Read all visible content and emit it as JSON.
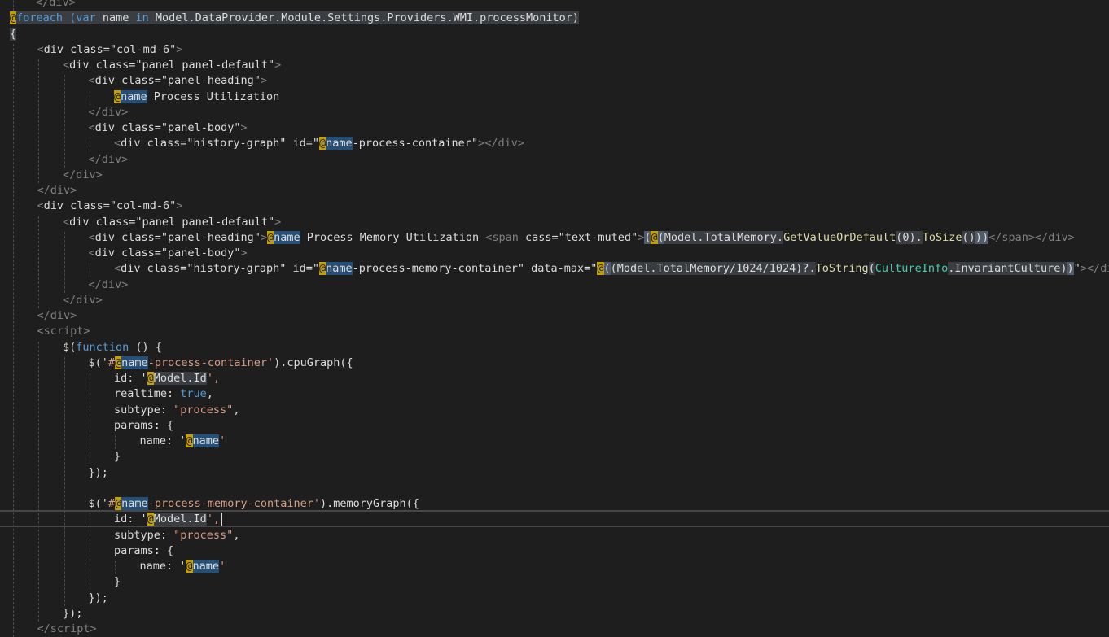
{
  "editor": {
    "theme_colors": {
      "background": "#1e1e1e",
      "razor_marker": "#c4a000",
      "keyword": "#569cd6",
      "tag_bracket": "#808080",
      "js_string": "#d69d85",
      "type": "#4ec9b0",
      "method": "#dcdcaa"
    },
    "current_line_index": 33,
    "lines": [
      {
        "indent": 1,
        "tokens": [
          {
            "t": "</div>",
            "k": "tag"
          }
        ]
      },
      {
        "indent": 0,
        "tokens": [
          {
            "t": "@",
            "k": "razor"
          },
          {
            "t": "foreach (",
            "k": "keyword"
          },
          {
            "t": "var",
            "k": "keyword"
          },
          {
            "t": " name ",
            "k": "plain"
          },
          {
            "t": "in",
            "k": "keyword"
          },
          {
            "t": " Model.DataProvider.Module.Settings.Providers.WMI.processMonitor)",
            "k": "plain"
          }
        ],
        "block_bg": true
      },
      {
        "indent": 0,
        "tokens": [
          {
            "t": "{",
            "k": "plain"
          }
        ],
        "block_bg": true
      },
      {
        "indent": 1,
        "tokens": [
          {
            "t": "<",
            "k": "tag"
          },
          {
            "t": "div",
            "k": "tagname"
          },
          {
            "t": " class=\"col-md-6\"",
            "k": "attr"
          },
          {
            "t": ">",
            "k": "tag"
          }
        ]
      },
      {
        "indent": 2,
        "tokens": [
          {
            "t": "<",
            "k": "tag"
          },
          {
            "t": "div",
            "k": "tagname"
          },
          {
            "t": " class=\"panel panel-default\"",
            "k": "attr"
          },
          {
            "t": ">",
            "k": "tag"
          }
        ]
      },
      {
        "indent": 3,
        "tokens": [
          {
            "t": "<",
            "k": "tag"
          },
          {
            "t": "div",
            "k": "tagname"
          },
          {
            "t": " class=\"panel-heading\"",
            "k": "attr"
          },
          {
            "t": ">",
            "k": "tag"
          }
        ]
      },
      {
        "indent": 4,
        "tokens": [
          {
            "t": "@",
            "k": "razor"
          },
          {
            "t": "name",
            "k": "varbox"
          },
          {
            "t": " Process Utilization",
            "k": "text"
          }
        ]
      },
      {
        "indent": 3,
        "tokens": [
          {
            "t": "</",
            "k": "tag"
          },
          {
            "t": "div",
            "k": "tag"
          },
          {
            "t": ">",
            "k": "tag"
          }
        ]
      },
      {
        "indent": 3,
        "tokens": [
          {
            "t": "<",
            "k": "tag"
          },
          {
            "t": "div",
            "k": "tagname"
          },
          {
            "t": " class=\"panel-body\"",
            "k": "attr"
          },
          {
            "t": ">",
            "k": "tag"
          }
        ]
      },
      {
        "indent": 4,
        "tokens": [
          {
            "t": "<",
            "k": "tag"
          },
          {
            "t": "div",
            "k": "tagname"
          },
          {
            "t": " class=\"history-graph\" id=\"",
            "k": "attr"
          },
          {
            "t": "@",
            "k": "razor"
          },
          {
            "t": "name",
            "k": "varbox"
          },
          {
            "t": "-process-container\"",
            "k": "attr"
          },
          {
            "t": "></",
            "k": "tag"
          },
          {
            "t": "div",
            "k": "tag"
          },
          {
            "t": ">",
            "k": "tag"
          }
        ]
      },
      {
        "indent": 3,
        "tokens": [
          {
            "t": "</",
            "k": "tag"
          },
          {
            "t": "div",
            "k": "tag"
          },
          {
            "t": ">",
            "k": "tag"
          }
        ]
      },
      {
        "indent": 2,
        "tokens": [
          {
            "t": "</",
            "k": "tag"
          },
          {
            "t": "div",
            "k": "tag"
          },
          {
            "t": ">",
            "k": "tag"
          }
        ]
      },
      {
        "indent": 1,
        "tokens": [
          {
            "t": "</",
            "k": "tag"
          },
          {
            "t": "div",
            "k": "tag"
          },
          {
            "t": ">",
            "k": "tag"
          }
        ]
      },
      {
        "indent": 1,
        "tokens": [
          {
            "t": "<",
            "k": "tag"
          },
          {
            "t": "div",
            "k": "tagname"
          },
          {
            "t": " class=\"col-md-6\"",
            "k": "attr"
          },
          {
            "t": ">",
            "k": "tag"
          }
        ]
      },
      {
        "indent": 2,
        "tokens": [
          {
            "t": "<",
            "k": "tag"
          },
          {
            "t": "div",
            "k": "tagname"
          },
          {
            "t": " class=\"panel panel-default\"",
            "k": "attr"
          },
          {
            "t": ">",
            "k": "tag"
          }
        ]
      },
      {
        "indent": 3,
        "tokens": [
          {
            "t": "<",
            "k": "tag"
          },
          {
            "t": "div",
            "k": "tagname"
          },
          {
            "t": " class=\"panel-heading\"",
            "k": "attr"
          },
          {
            "t": ">",
            "k": "tag"
          },
          {
            "t": "@",
            "k": "razor"
          },
          {
            "t": "name",
            "k": "varbox"
          },
          {
            "t": " Process Memory Utilization ",
            "k": "text"
          },
          {
            "t": "<",
            "k": "tag"
          },
          {
            "t": "span",
            "k": "tag"
          },
          {
            "t": " cass=\"text-muted\"",
            "k": "attr"
          },
          {
            "t": ">",
            "k": "tag"
          },
          {
            "t": "(",
            "k": "yellowparen"
          },
          {
            "t": "@",
            "k": "razor"
          },
          {
            "t": "(",
            "k": "yellowparen"
          },
          {
            "t": "Model.TotalMemory.",
            "k": "razorhl"
          },
          {
            "t": "GetValueOrDefault",
            "k": "method"
          },
          {
            "t": "(0).",
            "k": "razorhl"
          },
          {
            "t": "ToSize",
            "k": "method"
          },
          {
            "t": "()",
            "k": "razorhl"
          },
          {
            "t": ")",
            "k": "yellowparen"
          },
          {
            "t": ")",
            "k": "yellowparen"
          },
          {
            "t": "</",
            "k": "tag"
          },
          {
            "t": "span",
            "k": "tag"
          },
          {
            "t": "></",
            "k": "tag"
          },
          {
            "t": "div",
            "k": "tag"
          },
          {
            "t": ">",
            "k": "tag"
          }
        ]
      },
      {
        "indent": 3,
        "tokens": [
          {
            "t": "<",
            "k": "tag"
          },
          {
            "t": "div",
            "k": "tagname"
          },
          {
            "t": " class=\"panel-body\"",
            "k": "attr"
          },
          {
            "t": ">",
            "k": "tag"
          }
        ]
      },
      {
        "indent": 4,
        "tokens": [
          {
            "t": "<",
            "k": "tag"
          },
          {
            "t": "div",
            "k": "tagname"
          },
          {
            "t": " class=\"history-graph\" id=\"",
            "k": "attr"
          },
          {
            "t": "@",
            "k": "razor"
          },
          {
            "t": "name",
            "k": "varbox"
          },
          {
            "t": "-process-memory-container\" data-max=\"",
            "k": "attr"
          },
          {
            "t": "@",
            "k": "razor"
          },
          {
            "t": "(",
            "k": "yellowparen"
          },
          {
            "t": "(Model.TotalMemory/1024/1024)?.",
            "k": "razorhl"
          },
          {
            "t": "ToString",
            "k": "method"
          },
          {
            "t": "(",
            "k": "razorhl"
          },
          {
            "t": "CultureInfo",
            "k": "type"
          },
          {
            "t": ".InvariantCulture)",
            "k": "razorhl"
          },
          {
            "t": ")",
            "k": "yellowparen"
          },
          {
            "t": "\"",
            "k": "attr"
          },
          {
            "t": "></",
            "k": "tag"
          },
          {
            "t": "div",
            "k": "tag"
          },
          {
            "t": ">",
            "k": "tag"
          }
        ]
      },
      {
        "indent": 3,
        "tokens": [
          {
            "t": "</",
            "k": "tag"
          },
          {
            "t": "div",
            "k": "tag"
          },
          {
            "t": ">",
            "k": "tag"
          }
        ]
      },
      {
        "indent": 2,
        "tokens": [
          {
            "t": "</",
            "k": "tag"
          },
          {
            "t": "div",
            "k": "tag"
          },
          {
            "t": ">",
            "k": "tag"
          }
        ]
      },
      {
        "indent": 1,
        "tokens": [
          {
            "t": "</",
            "k": "tag"
          },
          {
            "t": "div",
            "k": "tag"
          },
          {
            "t": ">",
            "k": "tag"
          }
        ]
      },
      {
        "indent": 1,
        "tokens": [
          {
            "t": "<",
            "k": "tag"
          },
          {
            "t": "script",
            "k": "tag"
          },
          {
            "t": ">",
            "k": "tag"
          }
        ]
      },
      {
        "indent": 2,
        "tokens": [
          {
            "t": "$(",
            "k": "plain"
          },
          {
            "t": "function",
            "k": "keyword"
          },
          {
            "t": " () {",
            "k": "plain"
          }
        ]
      },
      {
        "indent": 3,
        "tokens": [
          {
            "t": "$('",
            "k": "plain"
          },
          {
            "t": "#",
            "k": "jsstring"
          },
          {
            "t": "@",
            "k": "razor"
          },
          {
            "t": "name",
            "k": "varbox"
          },
          {
            "t": "-process-container'",
            "k": "jsstring"
          },
          {
            "t": ").cpuGraph({",
            "k": "plain"
          }
        ]
      },
      {
        "indent": 4,
        "tokens": [
          {
            "t": "id: '",
            "k": "plain"
          },
          {
            "t": "@",
            "k": "razor"
          },
          {
            "t": "Model.Id",
            "k": "razorhl"
          },
          {
            "t": "',",
            "k": "jsstring"
          }
        ]
      },
      {
        "indent": 4,
        "tokens": [
          {
            "t": "realtime: ",
            "k": "plain"
          },
          {
            "t": "true",
            "k": "bool"
          },
          {
            "t": ",",
            "k": "plain"
          }
        ]
      },
      {
        "indent": 4,
        "tokens": [
          {
            "t": "subtype: ",
            "k": "plain"
          },
          {
            "t": "\"process\"",
            "k": "jsstring"
          },
          {
            "t": ",",
            "k": "plain"
          }
        ]
      },
      {
        "indent": 4,
        "tokens": [
          {
            "t": "params: {",
            "k": "plain"
          }
        ]
      },
      {
        "indent": 5,
        "tokens": [
          {
            "t": "name: '",
            "k": "plain"
          },
          {
            "t": "@",
            "k": "razor"
          },
          {
            "t": "name",
            "k": "varbox"
          },
          {
            "t": "'",
            "k": "jsstring"
          }
        ]
      },
      {
        "indent": 4,
        "tokens": [
          {
            "t": "}",
            "k": "plain"
          }
        ]
      },
      {
        "indent": 3,
        "tokens": [
          {
            "t": "});",
            "k": "plain"
          }
        ]
      },
      {
        "indent": 0,
        "tokens": []
      },
      {
        "indent": 3,
        "tokens": [
          {
            "t": "$('",
            "k": "plain"
          },
          {
            "t": "#",
            "k": "jsstring"
          },
          {
            "t": "@",
            "k": "razor"
          },
          {
            "t": "name",
            "k": "varbox"
          },
          {
            "t": "-process-memory-container'",
            "k": "jsstring"
          },
          {
            "t": ").memoryGraph({",
            "k": "plain"
          }
        ]
      },
      {
        "indent": 4,
        "tokens": [
          {
            "t": "id: '",
            "k": "plain"
          },
          {
            "t": "@",
            "k": "razor"
          },
          {
            "t": "Model.Id",
            "k": "razorhl"
          },
          {
            "t": "',",
            "k": "jsstring"
          }
        ],
        "caret": true
      },
      {
        "indent": 4,
        "tokens": [
          {
            "t": "subtype: ",
            "k": "plain"
          },
          {
            "t": "\"process\"",
            "k": "jsstring"
          },
          {
            "t": ",",
            "k": "plain"
          }
        ]
      },
      {
        "indent": 4,
        "tokens": [
          {
            "t": "params: {",
            "k": "plain"
          }
        ]
      },
      {
        "indent": 5,
        "tokens": [
          {
            "t": "name: '",
            "k": "plain"
          },
          {
            "t": "@",
            "k": "razor"
          },
          {
            "t": "name",
            "k": "varbox"
          },
          {
            "t": "'",
            "k": "jsstring"
          }
        ]
      },
      {
        "indent": 4,
        "tokens": [
          {
            "t": "}",
            "k": "plain"
          }
        ]
      },
      {
        "indent": 3,
        "tokens": [
          {
            "t": "});",
            "k": "plain"
          }
        ]
      },
      {
        "indent": 2,
        "tokens": [
          {
            "t": "});",
            "k": "plain"
          }
        ]
      },
      {
        "indent": 1,
        "tokens": [
          {
            "t": "</",
            "k": "tag"
          },
          {
            "t": "script",
            "k": "tag"
          },
          {
            "t": ">",
            "k": "tag"
          }
        ]
      }
    ]
  }
}
